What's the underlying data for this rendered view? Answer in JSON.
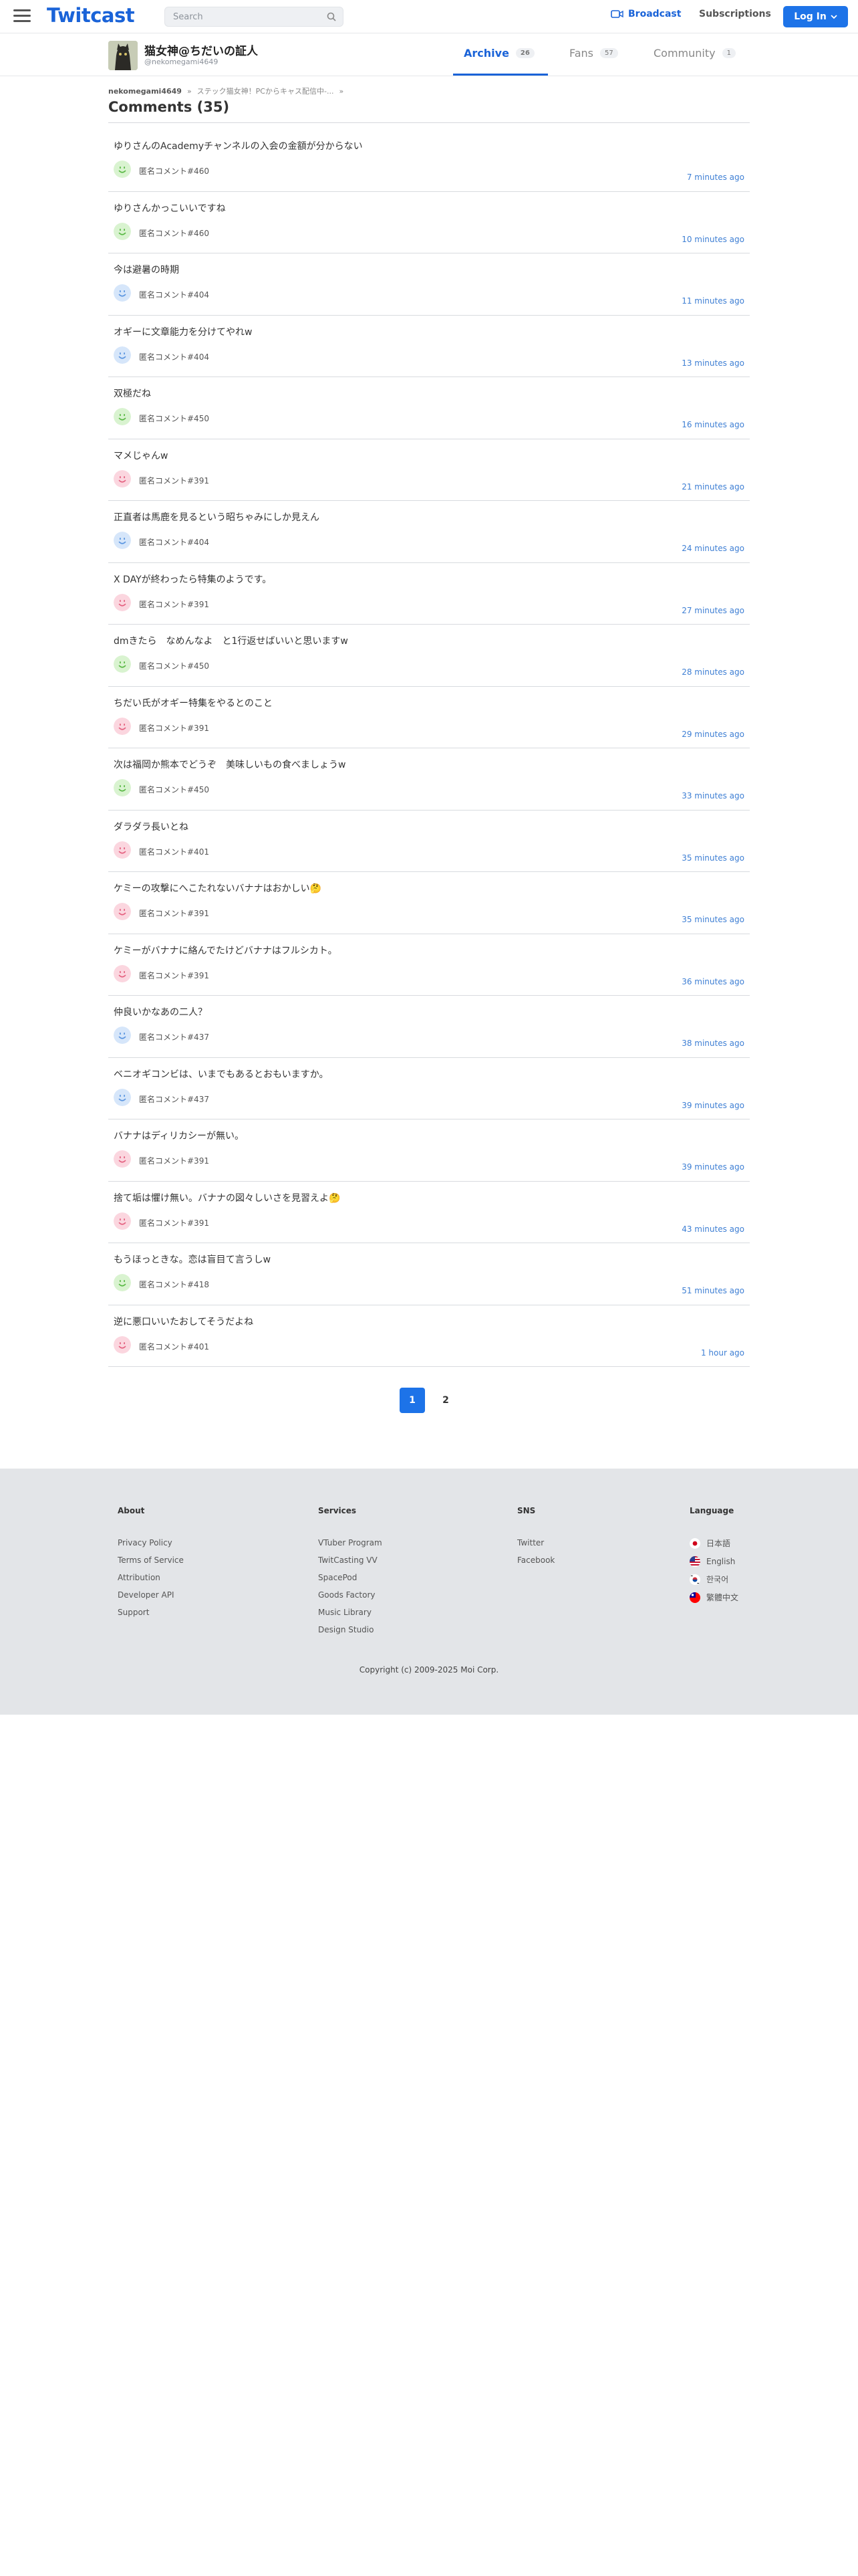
{
  "header": {
    "logo": "Twitcast",
    "search_placeholder": "Search",
    "broadcast_label": "Broadcast",
    "subscriptions_label": "Subscriptions",
    "login_label": "Log In"
  },
  "profile": {
    "name": "猫女神@ちだいの証人",
    "handle": "@nekomegami4649",
    "tabs": [
      {
        "label": "Archive",
        "count": "26"
      },
      {
        "label": "Fans",
        "count": "57"
      },
      {
        "label": "Community",
        "count": "1"
      }
    ]
  },
  "breadcrumb": {
    "user": "nekomegami4649",
    "sep": "»",
    "movie": "ステック猫女神！PCからキャス配信中-...",
    "arrow": "»"
  },
  "page_title": "Comments (35)",
  "comments": [
    {
      "text": "ゆりさんのAcademyチャンネルの入会の金額が分からない",
      "user": "匿名コメント#460",
      "time": "7 minutes ago",
      "color": "green"
    },
    {
      "text": "ゆりさんかっこいいですね",
      "user": "匿名コメント#460",
      "time": "10 minutes ago",
      "color": "green"
    },
    {
      "text": "今は避暑の時期",
      "user": "匿名コメント#404",
      "time": "11 minutes ago",
      "color": "blue"
    },
    {
      "text": "オギーに文章能力を分けてやれw",
      "user": "匿名コメント#404",
      "time": "13 minutes ago",
      "color": "blue"
    },
    {
      "text": "双極だね",
      "user": "匿名コメント#450",
      "time": "16 minutes ago",
      "color": "green"
    },
    {
      "text": "マメじゃんw",
      "user": "匿名コメント#391",
      "time": "21 minutes ago",
      "color": "pink"
    },
    {
      "text": "正直者は馬鹿を見るという昭ちゃみにしか見えん",
      "user": "匿名コメント#404",
      "time": "24 minutes ago",
      "color": "blue"
    },
    {
      "text": "X DAYが終わったら特集のようです。",
      "user": "匿名コメント#391",
      "time": "27 minutes ago",
      "color": "pink"
    },
    {
      "text": "dmきたら　なめんなよ　と1行返せばいいと思いますw",
      "user": "匿名コメント#450",
      "time": "28 minutes ago",
      "color": "green"
    },
    {
      "text": "ちだい氏がオギー特集をやるとのこと",
      "user": "匿名コメント#391",
      "time": "29 minutes ago",
      "color": "pink"
    },
    {
      "text": "次は福岡か熊本でどうぞ　美味しいもの食べましょうw",
      "user": "匿名コメント#450",
      "time": "33 minutes ago",
      "color": "green"
    },
    {
      "text": "ダラダラ長いとね",
      "user": "匿名コメント#401",
      "time": "35 minutes ago",
      "color": "pink"
    },
    {
      "text": "ケミーの攻撃にへこたれないバナナはおかしい🤔",
      "user": "匿名コメント#391",
      "time": "35 minutes ago",
      "color": "pink"
    },
    {
      "text": "ケミーがバナナに絡んでたけどバナナはフルシカト。",
      "user": "匿名コメント#391",
      "time": "36 minutes ago",
      "color": "pink"
    },
    {
      "text": "仲良いかなあの二人？",
      "user": "匿名コメント#437",
      "time": "38 minutes ago",
      "color": "blue"
    },
    {
      "text": "ベニオギコンビは、いまでもあるとおもいますか。",
      "user": "匿名コメント#437",
      "time": "39 minutes ago",
      "color": "blue"
    },
    {
      "text": "バナナはディリカシーが無い。",
      "user": "匿名コメント#391",
      "time": "39 minutes ago",
      "color": "pink"
    },
    {
      "text": "捨て垢は懼け無い。バナナの図々しいさを見習えよ🤔",
      "user": "匿名コメント#391",
      "time": "43 minutes ago",
      "color": "pink"
    },
    {
      "text": "もうほっときな。恋は盲目て言うしw",
      "user": "匿名コメント#418",
      "time": "51 minutes ago",
      "color": "green"
    },
    {
      "text": "逆に悪口いいたおしてそうだよね",
      "user": "匿名コメント#401",
      "time": "1 hour ago",
      "color": "pink"
    }
  ],
  "avatar_colors": {
    "green": {
      "bg": "#d9f3d0",
      "fg": "#58b843"
    },
    "blue": {
      "bg": "#d6e6fa",
      "fg": "#5a95e0"
    },
    "pink": {
      "bg": "#fbd6df",
      "fg": "#e4607f"
    }
  },
  "pagination": {
    "pages": [
      "1",
      "2"
    ],
    "current": "1"
  },
  "footer": {
    "about": {
      "title": "About",
      "links": [
        "Privacy Policy",
        "Terms of Service",
        "Attribution",
        "Developer API",
        "Support"
      ]
    },
    "services": {
      "title": "Services",
      "links": [
        "VTuber Program",
        "TwitCasting VV",
        "SpacePod",
        "Goods Factory",
        "Music Library",
        "Design Studio"
      ]
    },
    "sns": {
      "title": "SNS",
      "links": [
        "Twitter",
        "Facebook"
      ]
    },
    "language": {
      "title": "Language",
      "items": [
        {
          "label": "日本語",
          "flag": "jp"
        },
        {
          "label": "English",
          "flag": "us"
        },
        {
          "label": "한국어",
          "flag": "kr"
        },
        {
          "label": "繁體中文",
          "flag": "tw"
        }
      ]
    },
    "copyright": "Copyright (c) 2009-2025 Moi Corp."
  },
  "colors": {
    "accent": "#1d73e8",
    "link": "#3e7fd4",
    "footer_bg": "#e3e5e8"
  }
}
